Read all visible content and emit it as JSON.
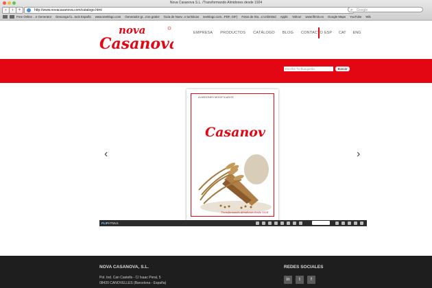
{
  "browser": {
    "window_title": "Nova Casanova S.L. /Transformando Almidones desde 1924",
    "url": "http://www.novacasanova.com/catalogo.html",
    "search_placeholder": "Google",
    "bookmarks": [
      "Free Online ...e Generator",
      "Descarga fo...tock España",
      "www.seeklogo.com",
      "Generador gr...rros gratis!",
      "Guía de Nuev...s turísticas",
      "seeklogo.com...PDF, GIF)",
      "Fotos de Sto...s Unlimited",
      "Apple",
      "Yahoo!",
      "www.filmin.es",
      "Google Maps",
      "YouTube",
      "Wik"
    ]
  },
  "site": {
    "logo_top": "nova",
    "logo_main": "Casanova",
    "nav": [
      "EMPRESA",
      "PRODUCTOS",
      "CATÁLOGO",
      "BLOG",
      "CONTACTO"
    ],
    "languages": [
      "ESP",
      "CAT",
      "ENG"
    ],
    "search_placeholder": "Escribe Tu Busqueda",
    "search_button": "Buscar"
  },
  "catalog": {
    "subtitle": "ALMIDONES MODIFICADOS",
    "brand": "Casanova",
    "tagline": "Transformando Almidones desde 1924",
    "viewer_brand": "FLIP",
    "viewer_brand_suffix": "HTML5"
  },
  "footer": {
    "company": "NOVA CASANOVA, S.L.",
    "address_1": "Pol. Ind. Can Castells - C/ Isaac Peral, 5",
    "address_2": "08420 CANOVELLES (Barcelona - España)",
    "social_title": "REDES SOCIALES",
    "social": [
      "in",
      "t",
      "f"
    ]
  },
  "colors": {
    "brand_red": "#e30613",
    "footer_bg": "#1e1e1e"
  }
}
